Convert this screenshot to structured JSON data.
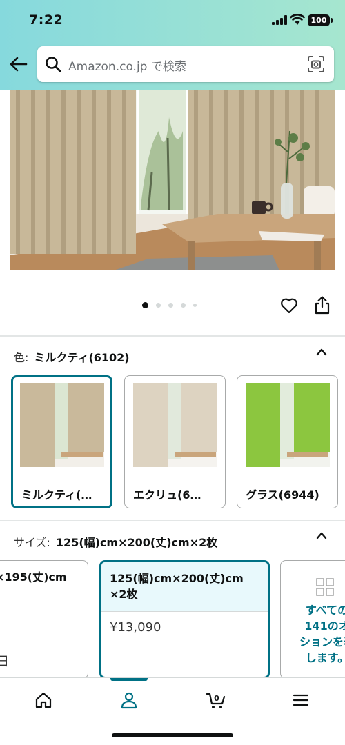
{
  "status_bar": {
    "time": "7:22",
    "battery": "100"
  },
  "search": {
    "placeholder": "Amazon.co.jp で検索"
  },
  "gallery": {
    "image_count": 5,
    "active_index": 0
  },
  "color_option": {
    "label": "色:",
    "selected_value": "ミルクティ(6102)",
    "swatches": [
      {
        "label": "ミルクティ(…",
        "color": "#c9b99b",
        "selected": true
      },
      {
        "label": "エクリュ(6…",
        "color": "#ddd3c1",
        "selected": false
      },
      {
        "label": "グラス(6944)",
        "color": "#8cc63f",
        "selected": false
      }
    ]
  },
  "size_option": {
    "label": "サイズ:",
    "selected_value": "125(幅)cm×200(丈)cm×2枚",
    "cards": [
      {
        "title_line1": "×195(丈)cm",
        "title_line2": "",
        "price": "",
        "note": "日"
      },
      {
        "title_line1": "125(幅)cm×200(丈)cm",
        "title_line2": "×2枚",
        "price": "¥13,090",
        "note": ""
      }
    ],
    "see_all": {
      "line1": "すべての",
      "line2": "141のオ",
      "line3": "ションを表",
      "line4": "します。"
    }
  },
  "bottom_nav": {
    "cart_count": "0"
  },
  "colors": {
    "accent": "#007185",
    "header_from": "#86d9dd",
    "header_to": "#a6e6cf"
  }
}
